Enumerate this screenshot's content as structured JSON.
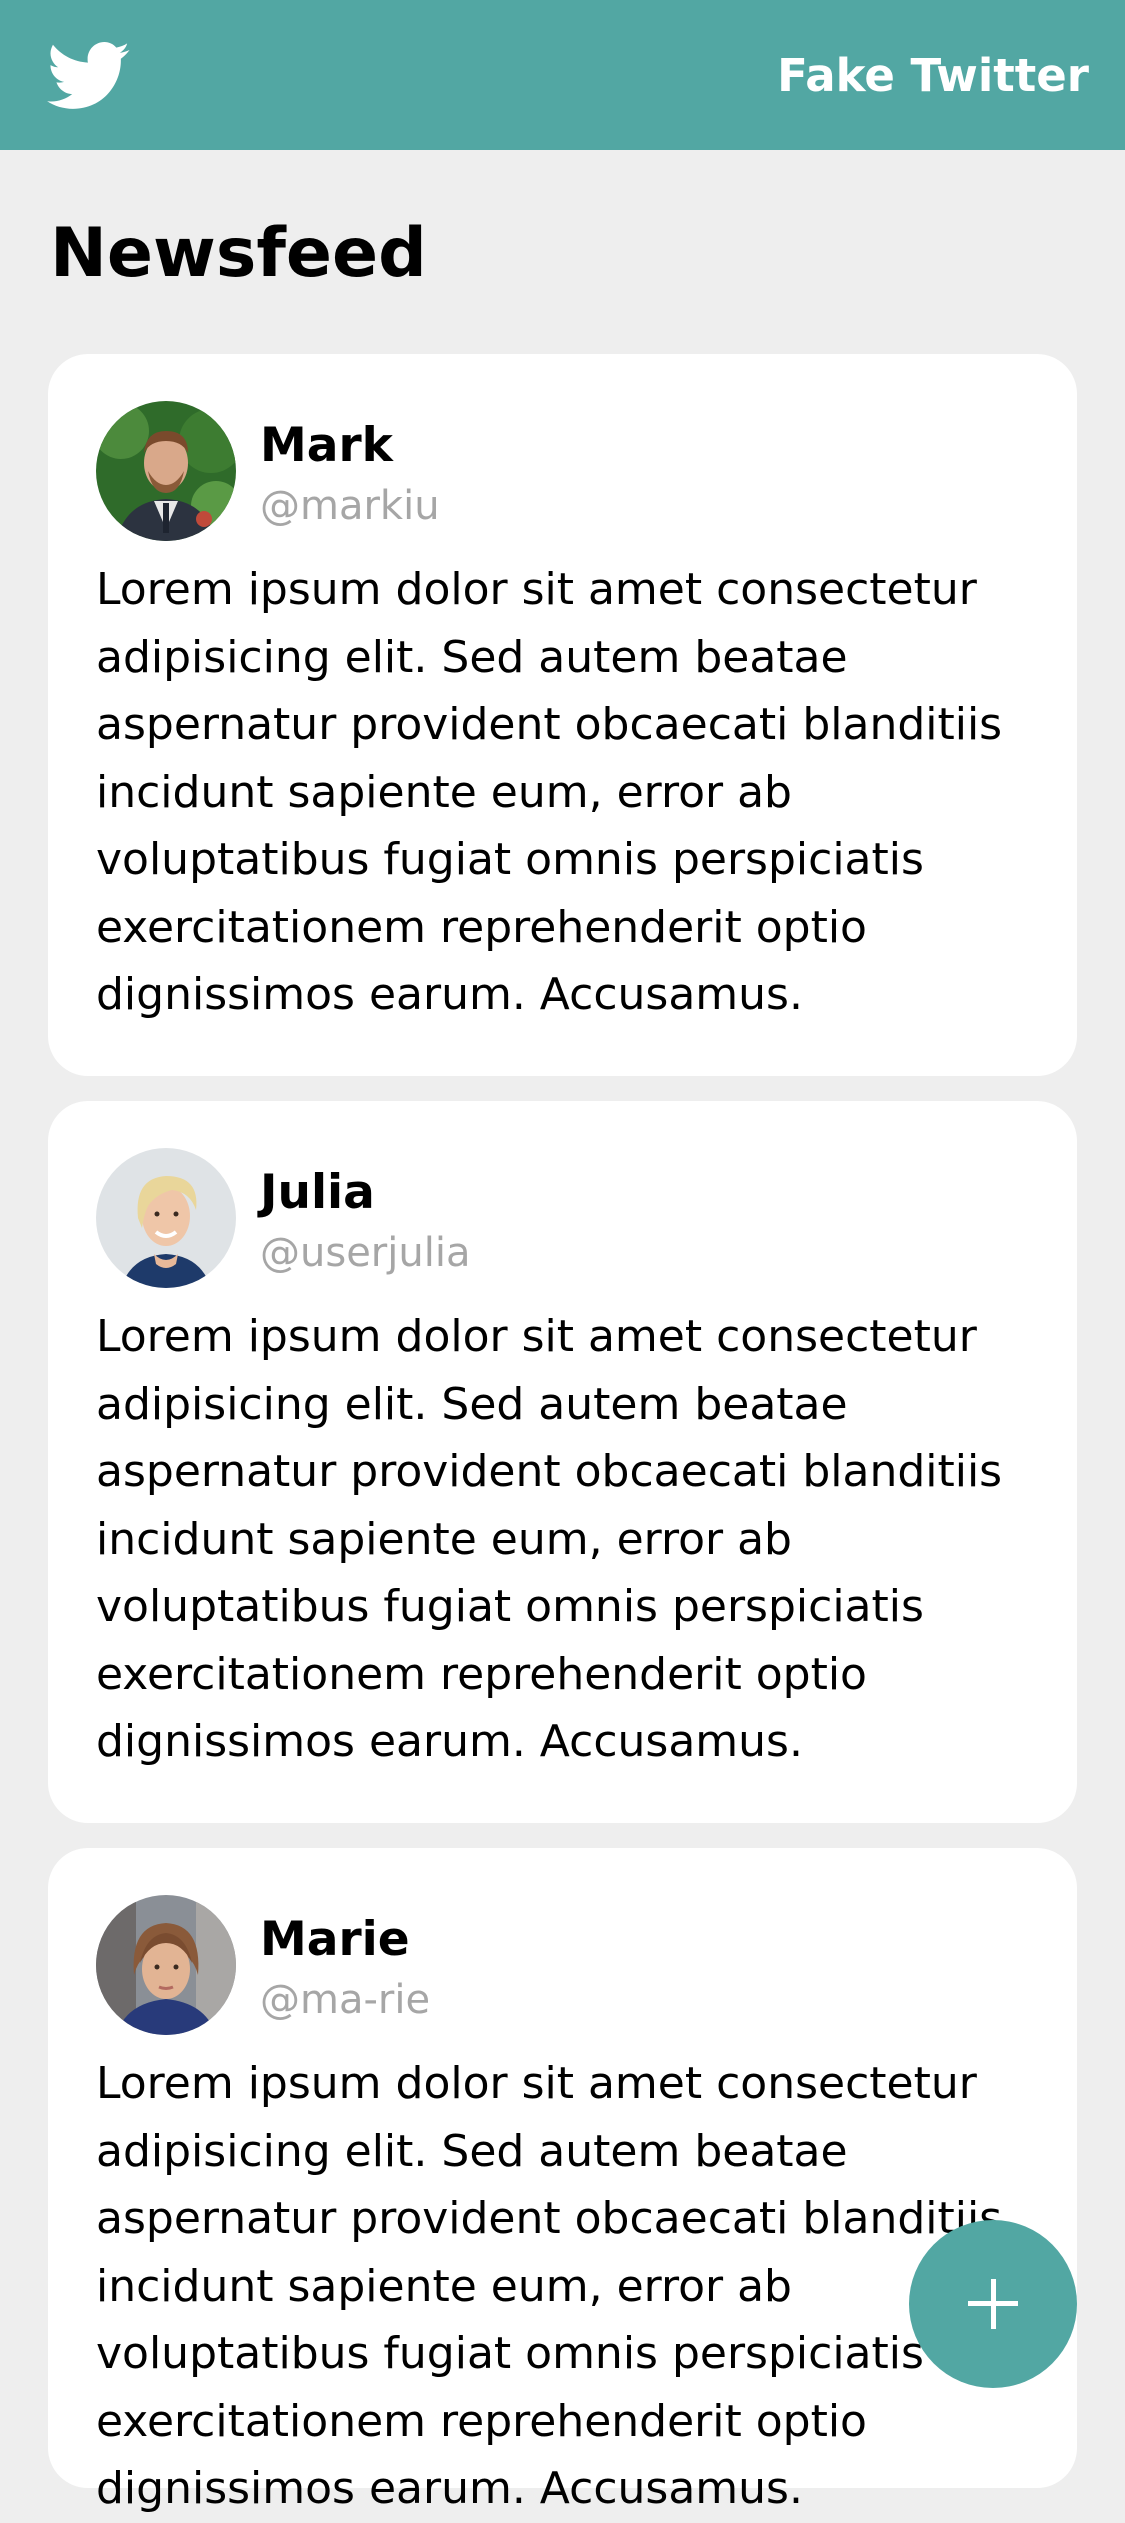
{
  "header": {
    "brand": "Fake Twitter",
    "logo_icon": "twitter-bird-icon"
  },
  "feed": {
    "title": "Newsfeed"
  },
  "posts": [
    {
      "name": "Mark",
      "handle": "@markiu",
      "text": "Lorem ipsum dolor sit amet consectetur\nadipisicing elit. Sed autem beatae\naspernatur provident obcaecati blanditiis\nincidunt sapiente eum, error ab\nvoluptatibus fugiat omnis perspiciatis\nexercitationem reprehenderit optio\ndignissimos earum. Accusamus."
    },
    {
      "name": "Julia",
      "handle": "@userjulia",
      "text": "Lorem ipsum dolor sit amet consectetur\nadipisicing elit. Sed autem beatae\naspernatur provident obcaecati blanditiis\nincidunt sapiente eum, error ab\nvoluptatibus fugiat omnis perspiciatis\nexercitationem reprehenderit optio\ndignissimos earum. Accusamus."
    },
    {
      "name": "Marie",
      "handle": "@ma-rie",
      "text": "Lorem ipsum dolor sit amet consectetur\nadipisicing elit. Sed autem beatae\naspernatur provident obcaecati blanditiis\nincidunt sapiente eum, error ab\nvoluptatibus fugiat omnis perspiciatis\nexercitationem reprehenderit optio\ndignissimos earum. Accusamus."
    }
  ],
  "fab": {
    "icon": "plus-icon"
  },
  "colors": {
    "accent": "#52a7a3",
    "background": "#eeeeee",
    "card": "#ffffff",
    "handle": "#a6a6a6"
  }
}
